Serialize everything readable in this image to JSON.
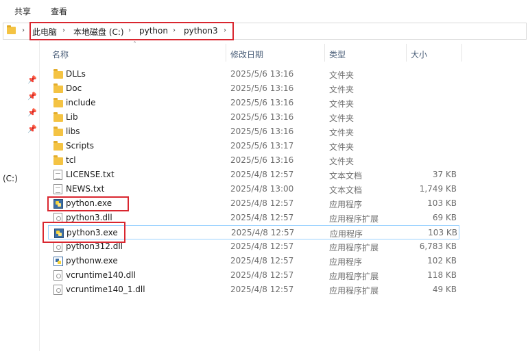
{
  "ribbon": {
    "tabs": [
      "共享",
      "查看"
    ]
  },
  "address": {
    "crumbs": [
      "此电脑",
      "本地磁盘 (C:)",
      "python",
      "python3"
    ],
    "sep": "›"
  },
  "nav": {
    "drive_label": "(C:)",
    "pin_icon": "📌"
  },
  "columns": {
    "name": "名称",
    "date": "修改日期",
    "type": "类型",
    "size": "大小",
    "sort_glyph": "˄"
  },
  "files": [
    {
      "name": "DLLs",
      "date": "2025/5/6 13:16",
      "type": "文件夹",
      "size": "",
      "icon": "folder"
    },
    {
      "name": "Doc",
      "date": "2025/5/6 13:16",
      "type": "文件夹",
      "size": "",
      "icon": "folder"
    },
    {
      "name": "include",
      "date": "2025/5/6 13:16",
      "type": "文件夹",
      "size": "",
      "icon": "folder"
    },
    {
      "name": "Lib",
      "date": "2025/5/6 13:16",
      "type": "文件夹",
      "size": "",
      "icon": "folder"
    },
    {
      "name": "libs",
      "date": "2025/5/6 13:16",
      "type": "文件夹",
      "size": "",
      "icon": "folder"
    },
    {
      "name": "Scripts",
      "date": "2025/5/6 13:17",
      "type": "文件夹",
      "size": "",
      "icon": "folder"
    },
    {
      "name": "tcl",
      "date": "2025/5/6 13:16",
      "type": "文件夹",
      "size": "",
      "icon": "folder"
    },
    {
      "name": "LICENSE.txt",
      "date": "2025/4/8 12:57",
      "type": "文本文档",
      "size": "37 KB",
      "icon": "doc"
    },
    {
      "name": "NEWS.txt",
      "date": "2025/4/8 13:00",
      "type": "文本文档",
      "size": "1,749 KB",
      "icon": "doc"
    },
    {
      "name": "python.exe",
      "date": "2025/4/8 12:57",
      "type": "应用程序",
      "size": "103 KB",
      "icon": "exe"
    },
    {
      "name": "python3.dll",
      "date": "2025/4/8 12:57",
      "type": "应用程序扩展",
      "size": "69 KB",
      "icon": "dll"
    },
    {
      "name": "python3.exe",
      "date": "2025/4/8 12:57",
      "type": "应用程序",
      "size": "103 KB",
      "icon": "exe"
    },
    {
      "name": "python312.dll",
      "date": "2025/4/8 12:57",
      "type": "应用程序扩展",
      "size": "6,783 KB",
      "icon": "dll"
    },
    {
      "name": "pythonw.exe",
      "date": "2025/4/8 12:57",
      "type": "应用程序",
      "size": "102 KB",
      "icon": "exew"
    },
    {
      "name": "vcruntime140.dll",
      "date": "2025/4/8 12:57",
      "type": "应用程序扩展",
      "size": "118 KB",
      "icon": "dll"
    },
    {
      "name": "vcruntime140_1.dll",
      "date": "2025/4/8 12:57",
      "type": "应用程序扩展",
      "size": "49 KB",
      "icon": "dll"
    }
  ],
  "colors": {
    "highlight_box": "#d9262f",
    "selection_border": "#99d1ff",
    "header_text": "#4c607a"
  }
}
